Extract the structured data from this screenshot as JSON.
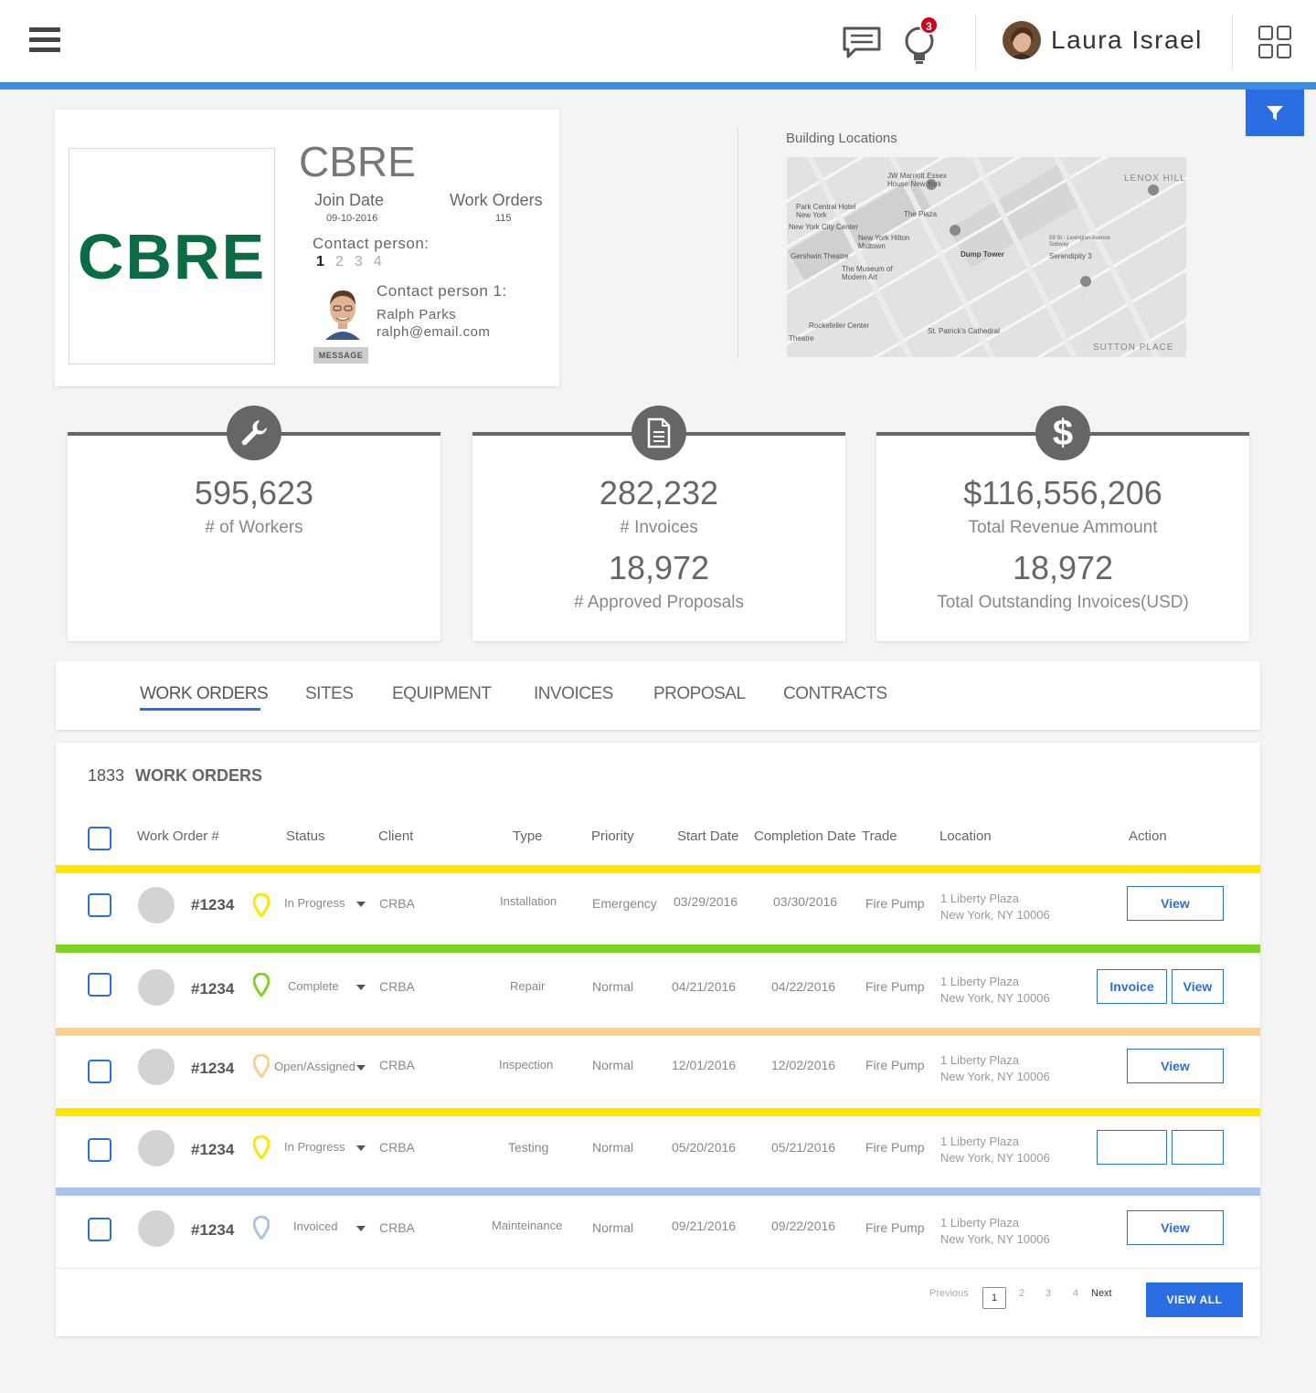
{
  "header": {
    "user_name": "Laura Israel",
    "notification_count": "3",
    "icons": [
      "menu-icon",
      "chat-icon",
      "lightbulb-icon",
      "apps-grid-icon",
      "filter-icon"
    ]
  },
  "company": {
    "logo_text": "CBRE",
    "name": "CBRE",
    "join_date_label": "Join Date",
    "join_date": "09-10-2016",
    "work_orders_label": "Work Orders",
    "work_orders": "115",
    "contact_label": "Contact person:",
    "contact_pages": [
      "1",
      "2",
      "3",
      "4"
    ],
    "contact1_label": "Contact person 1:",
    "contact1_name": "Ralph Parks",
    "contact1_email": "ralph@email.com",
    "message_label": "MESSAGE"
  },
  "map": {
    "title": "Building Locations",
    "labels": [
      "JW Marriott Essex House New York",
      "Park Central Hotel New York",
      "New York City Center",
      "The Plaza",
      "New York Hilton Midtown",
      "Gershwin Theatre",
      "The Museum of Modern Art",
      "Dump Tower",
      "59 St - Lexington Avenue Subway",
      "Serendipity 3",
      "LENOX HILL",
      "Rockefeller Center",
      "St. Patrick's Cathedral",
      "SUTTON PLACE",
      "Theatre"
    ]
  },
  "stats": [
    {
      "value": "595,623",
      "label": "# of Workers",
      "icon": "wrench-icon"
    },
    {
      "value": "282,232",
      "label": "# Invoices",
      "value2": "18,972",
      "label2": "# Approved Proposals",
      "icon": "document-icon"
    },
    {
      "value": "$116,556,206",
      "label": "Total Revenue Ammount",
      "value2": "18,972",
      "label2": "Total Outstanding Invoices(USD)",
      "icon": "dollar-icon"
    }
  ],
  "tabs": [
    "WORK ORDERS",
    "SITES",
    "EQUIPMENT",
    "INVOICES",
    "PROPOSAL",
    "CONTRACTS"
  ],
  "work_orders": {
    "count": "1833",
    "title": "WORK ORDERS",
    "columns": [
      "Work Order #",
      "Status",
      "Client",
      "Type",
      "Priority",
      "Start Date",
      "Completion Date",
      "Trade",
      "Location",
      "Action"
    ],
    "rows": [
      {
        "color": "#ffe600",
        "number": "#1234",
        "status": "In Progress",
        "client": "CRBA",
        "type": "Installation",
        "priority": "Emergency",
        "start": "03/29/2016",
        "completion": "03/30/2016",
        "trade": "Fire Pump",
        "loc1": "1 Liberty Plaza",
        "loc2": "New York, NY 10006",
        "actions": [
          "View"
        ]
      },
      {
        "color": "#7ed321",
        "number": "#1234",
        "status": "Complete",
        "client": "CRBA",
        "type": "Repair",
        "priority": "Normal",
        "start": "04/21/2016",
        "completion": "04/22/2016",
        "trade": "Fire Pump",
        "loc1": "1 Liberty Plaza",
        "loc2": "New York, NY 10006",
        "actions": [
          "Invoice",
          "View"
        ]
      },
      {
        "color": "#f8d08f",
        "number": "#1234",
        "status": "Open/Assigned",
        "client": "CRBA",
        "type": "Inspection",
        "priority": "Normal",
        "start": "12/01/2016",
        "completion": "12/02/2016",
        "trade": "Fire Pump",
        "loc1": "1 Liberty Plaza",
        "loc2": "New York, NY 10006",
        "actions": [
          "View"
        ]
      },
      {
        "color": "#ffe600",
        "number": "#1234",
        "status": "In Progress",
        "client": "CRBA",
        "type": "Testing",
        "priority": "Normal",
        "start": "05/20/2016",
        "completion": "05/21/2016",
        "trade": "Fire Pump",
        "loc1": "1 Liberty Plaza",
        "loc2": "New York, NY 10006",
        "actions": [
          "",
          ""
        ]
      },
      {
        "color": "#a9c3ec",
        "number": "#1234",
        "status": "Invoiced",
        "client": "CRBA",
        "type": "Mainteinance",
        "priority": "Normal",
        "start": "09/21/2016",
        "completion": "09/22/2016",
        "trade": "Fire Pump",
        "loc1": "1 Liberty Plaza",
        "loc2": "New York, NY 10006",
        "actions": [
          "View"
        ]
      }
    ],
    "pagination": {
      "previous": "Previous",
      "pages": [
        "1",
        "2",
        "3",
        "4"
      ],
      "next": "Next"
    },
    "view_all": "VIEW ALL"
  }
}
